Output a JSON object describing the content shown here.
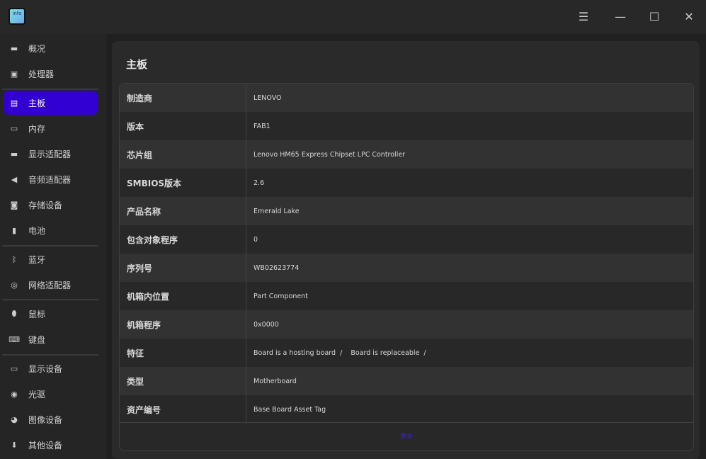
{
  "app": {
    "logo_text": "info"
  },
  "window": {
    "menu": "☰",
    "minimize": "—",
    "maximize": "☐",
    "close": "✕"
  },
  "sidebar": {
    "items": [
      {
        "label": "概况",
        "icon": "computer-icon",
        "glyph": "▬"
      },
      {
        "label": "处理器",
        "icon": "cpu-icon",
        "glyph": "▣"
      },
      {
        "label": "主板",
        "icon": "motherboard-icon",
        "glyph": "▤"
      },
      {
        "label": "内存",
        "icon": "memory-icon",
        "glyph": "▭"
      },
      {
        "label": "显示适配器",
        "icon": "display-adapter-icon",
        "glyph": "▬"
      },
      {
        "label": "音频适配器",
        "icon": "audio-icon",
        "glyph": "◀"
      },
      {
        "label": "存储设备",
        "icon": "storage-icon",
        "glyph": "◙"
      },
      {
        "label": "电池",
        "icon": "battery-icon",
        "glyph": "▮"
      },
      {
        "label": "蓝牙",
        "icon": "bluetooth-icon",
        "glyph": "ᛒ"
      },
      {
        "label": "网络适配器",
        "icon": "network-icon",
        "glyph": "◎"
      },
      {
        "label": "鼠标",
        "icon": "mouse-icon",
        "glyph": "⬮"
      },
      {
        "label": "键盘",
        "icon": "keyboard-icon",
        "glyph": "⌨"
      },
      {
        "label": "显示设备",
        "icon": "monitor-icon",
        "glyph": "▭"
      },
      {
        "label": "光驱",
        "icon": "optical-drive-icon",
        "glyph": "◉"
      },
      {
        "label": "图像设备",
        "icon": "camera-icon",
        "glyph": "◕"
      },
      {
        "label": "其他设备",
        "icon": "other-device-icon",
        "glyph": "⬇"
      }
    ]
  },
  "main": {
    "title": "主板",
    "more": "更多",
    "rows": [
      {
        "k": "制造商",
        "v": "LENOVO"
      },
      {
        "k": "版本",
        "v": "FAB1"
      },
      {
        "k": "芯片组",
        "v": "Lenovo HM65 Express Chipset LPC Controller"
      },
      {
        "k": "SMBIOS版本",
        "v": "2.6"
      },
      {
        "k": "产品名称",
        "v": "Emerald Lake"
      },
      {
        "k": "包含对象程序",
        "v": "0"
      },
      {
        "k": "序列号",
        "v": "WB02623774"
      },
      {
        "k": "机箱内位置",
        "v": "Part Component"
      },
      {
        "k": "机箱程序",
        "v": "0x0000"
      },
      {
        "k": "特征",
        "v": "Board is a hosting board  /    Board is replaceable  /"
      },
      {
        "k": "类型",
        "v": "Motherboard"
      },
      {
        "k": "资产编号",
        "v": "Base Board Asset Tag"
      }
    ]
  }
}
